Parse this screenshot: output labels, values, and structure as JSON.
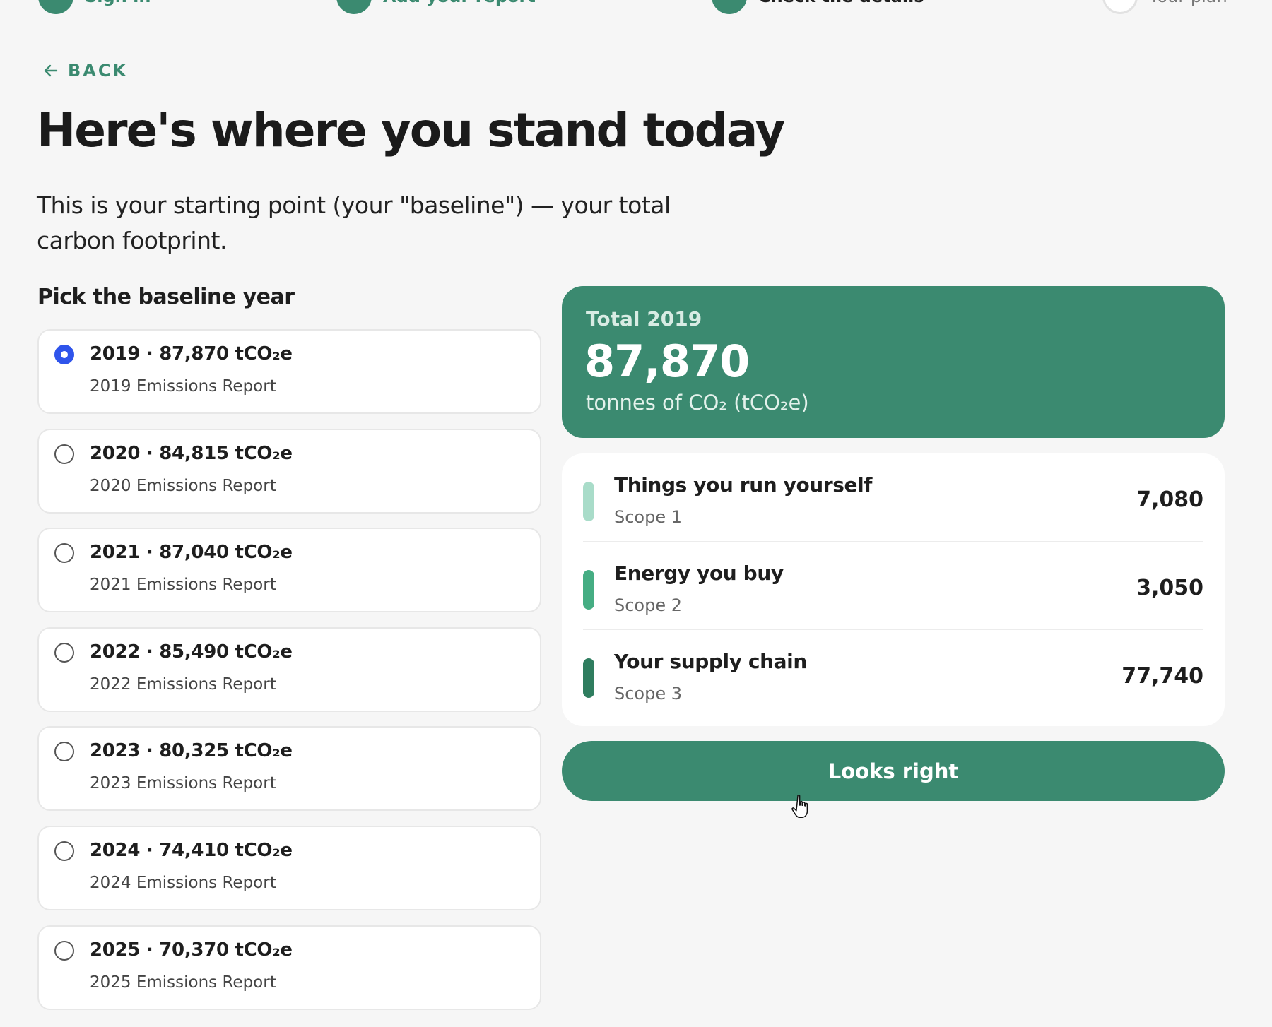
{
  "stepper": {
    "steps": [
      {
        "label": "Sign in"
      },
      {
        "label": "Add your report"
      },
      {
        "label": "Check the details"
      },
      {
        "label": "Your plan"
      }
    ]
  },
  "back": {
    "label": "BACK",
    "icon": "arrow-left-icon"
  },
  "page": {
    "title": "Here's where you stand today",
    "intro": "This is your starting point (your \"baseline\") — your total carbon footprint."
  },
  "baseline": {
    "heading": "Pick the baseline year",
    "selected_year": "2019",
    "options": [
      {
        "title": "2019 · 87,870 tCO₂e",
        "subtitle": "2019 Emissions Report",
        "selected": true
      },
      {
        "title": "2020 · 84,815 tCO₂e",
        "subtitle": "2020 Emissions Report",
        "selected": false
      },
      {
        "title": "2021 · 87,040 tCO₂e",
        "subtitle": "2021 Emissions Report",
        "selected": false
      },
      {
        "title": "2022 · 85,490 tCO₂e",
        "subtitle": "2022 Emissions Report",
        "selected": false
      },
      {
        "title": "2023 · 80,325 tCO₂e",
        "subtitle": "2023 Emissions Report",
        "selected": false
      },
      {
        "title": "2024 · 74,410 tCO₂e",
        "subtitle": "2024 Emissions Report",
        "selected": false
      },
      {
        "title": "2025 · 70,370 tCO₂e",
        "subtitle": "2025 Emissions Report",
        "selected": false
      }
    ]
  },
  "total": {
    "label": "Total 2019",
    "value": "87,870",
    "unit": "tonnes of CO₂ (tCO₂e)"
  },
  "scopes": [
    {
      "name": "Things you run yourself",
      "scope": "Scope 1",
      "value": "7,080",
      "color": "#a9dcc9"
    },
    {
      "name": "Energy you buy",
      "scope": "Scope 2",
      "value": "3,050",
      "color": "#45ad83"
    },
    {
      "name": "Your supply chain",
      "scope": "Scope 3",
      "value": "77,740",
      "color": "#2f7d5f"
    }
  ],
  "cta": {
    "label": "Looks right"
  },
  "colors": {
    "accent": "#3b8a70",
    "radio_selected": "#2f54eb",
    "background": "#f6f6f6"
  }
}
